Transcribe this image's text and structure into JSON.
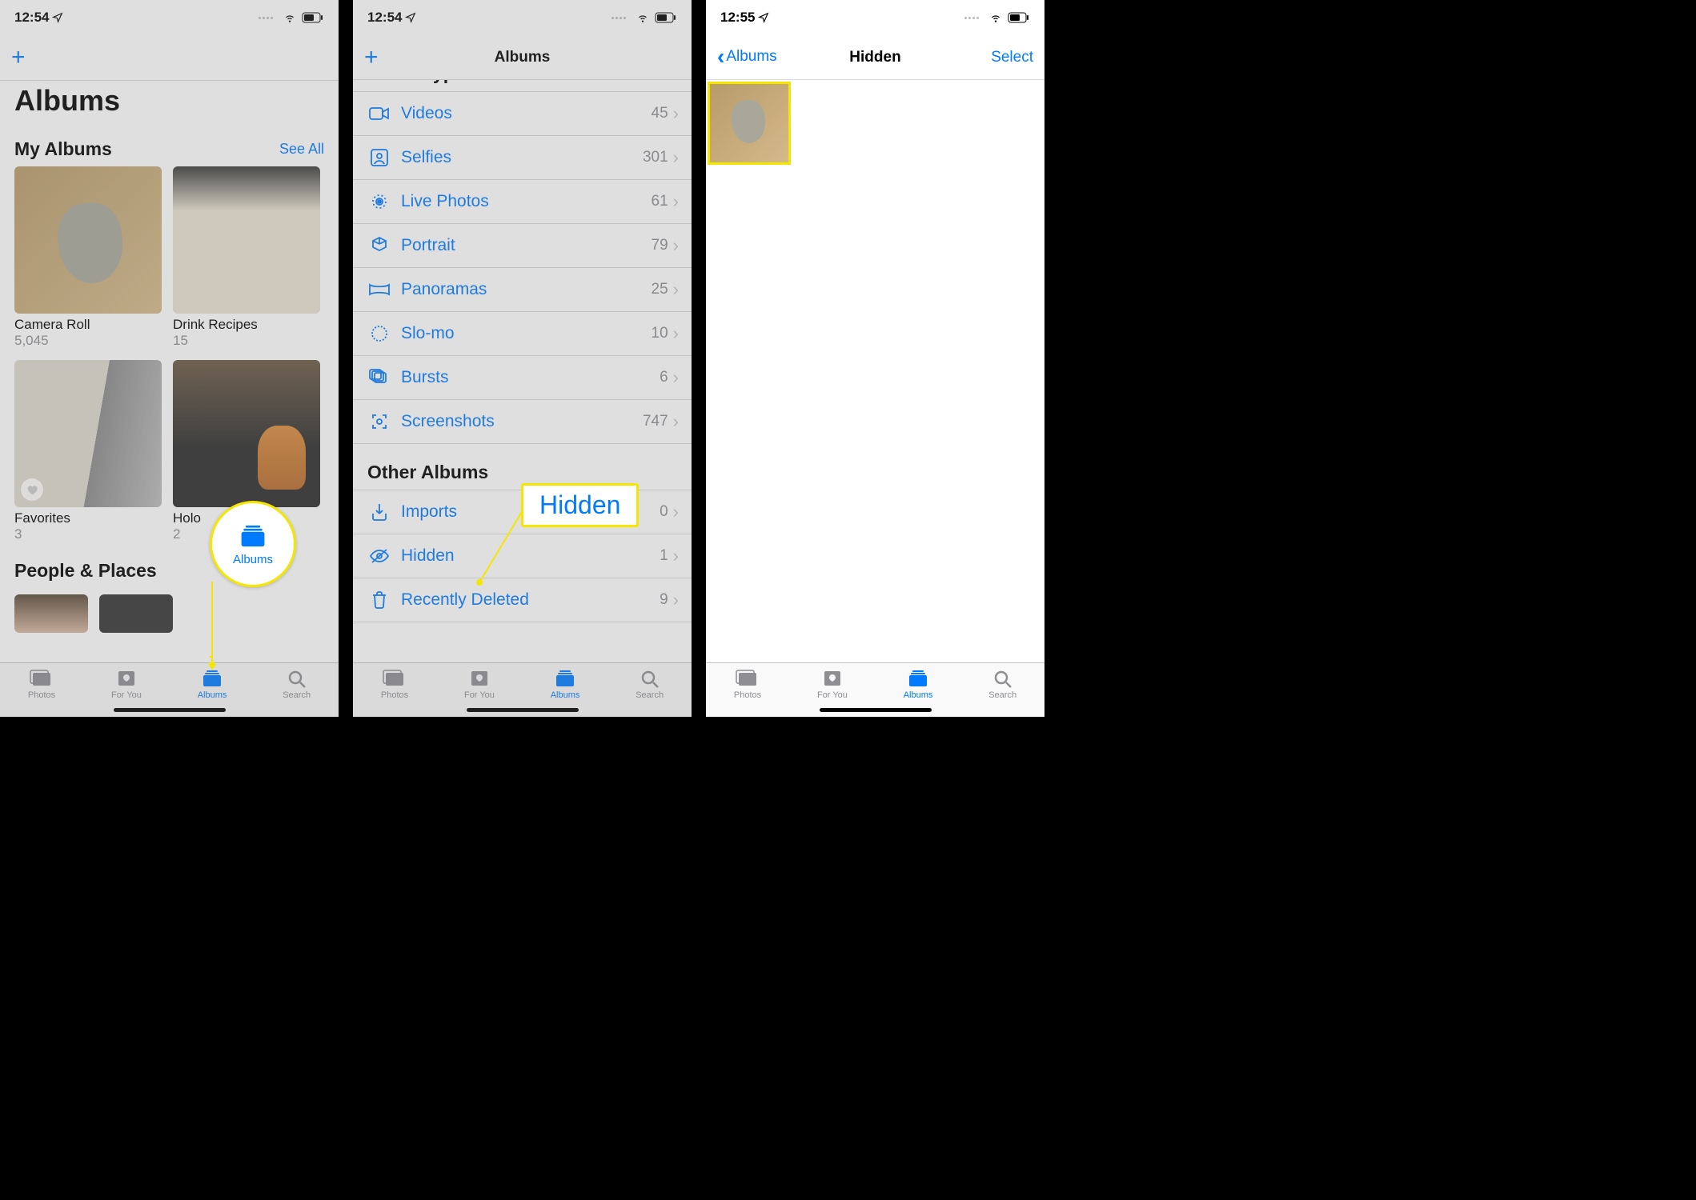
{
  "panel1": {
    "status_time": "12:54",
    "page_title": "Albums",
    "section_my_albums": "My Albums",
    "see_all": "See All",
    "albums": [
      {
        "name": "Camera Roll",
        "count": "5,045"
      },
      {
        "name": "Drink Recipes",
        "count": "15"
      },
      {
        "name": "Favorites",
        "count": "3"
      },
      {
        "name": "Holo",
        "count": "2"
      }
    ],
    "section_people_places": "People & Places",
    "callout_label": "Albums"
  },
  "panel2": {
    "status_time": "12:54",
    "nav_title": "Albums",
    "section_cut": "Media Types",
    "media_types": [
      {
        "label": "Videos",
        "count": "45",
        "icon": "video"
      },
      {
        "label": "Selfies",
        "count": "301",
        "icon": "selfie"
      },
      {
        "label": "Live Photos",
        "count": "61",
        "icon": "live"
      },
      {
        "label": "Portrait",
        "count": "79",
        "icon": "cube"
      },
      {
        "label": "Panoramas",
        "count": "25",
        "icon": "pano"
      },
      {
        "label": "Slo-mo",
        "count": "10",
        "icon": "slomo"
      },
      {
        "label": "Bursts",
        "count": "6",
        "icon": "burst"
      },
      {
        "label": "Screenshots",
        "count": "747",
        "icon": "screenshot"
      }
    ],
    "section_other": "Other Albums",
    "other_items": [
      {
        "label": "Imports",
        "count": "0",
        "icon": "import"
      },
      {
        "label": "Hidden",
        "count": "1",
        "icon": "hidden"
      },
      {
        "label": "Recently Deleted",
        "count": "9",
        "icon": "trash"
      }
    ],
    "callout_label": "Hidden"
  },
  "panel3": {
    "status_time": "12:55",
    "back_label": "Albums",
    "nav_title": "Hidden",
    "select_label": "Select"
  },
  "tabs": {
    "photos": "Photos",
    "foryou": "For You",
    "albums": "Albums",
    "search": "Search"
  }
}
